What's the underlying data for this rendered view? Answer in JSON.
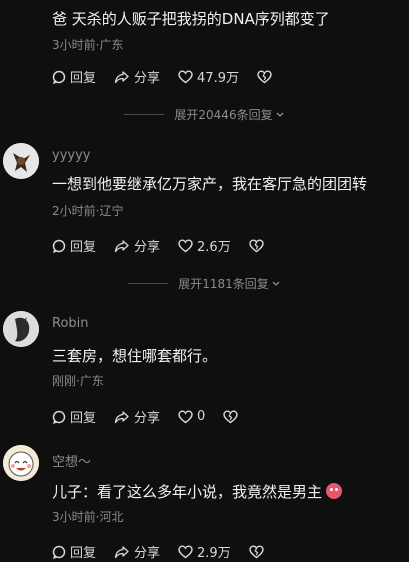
{
  "comments": [
    {
      "name": "",
      "text": "爸 天杀的人贩子把我拐的DNA序列都变了",
      "meta": "3小时前·广东",
      "reply": "回复",
      "share": "分享",
      "likes": "47.9万"
    },
    {
      "name": "yyyyy",
      "text": "一想到他要继承亿万家产，我在客厅急的团团转",
      "meta": "2小时前·辽宁",
      "reply": "回复",
      "share": "分享",
      "likes": "2.6万"
    },
    {
      "name": "Robin",
      "text": "三套房，想住哪套都行。",
      "meta": "刚刚·广东",
      "reply": "回复",
      "share": "分享",
      "likes": "0"
    },
    {
      "name": "空想～",
      "text": "儿子：看了这么多年小说，我竟然是男主",
      "meta": "3小时前·河北",
      "reply": "回复",
      "share": "分享",
      "likes": "2.9万"
    }
  ],
  "expands": [
    {
      "label": "展开20446条回复"
    },
    {
      "label": "展开1181条回复"
    }
  ],
  "icons": {
    "reply": "comment-bubble-icon",
    "share": "share-arrow-icon",
    "like": "heart-icon",
    "dislike": "broken-heart-icon",
    "chevron": "chevron-down-icon"
  },
  "colors": {
    "background": "#0f0f0f",
    "muted": "#8a8a8a"
  }
}
